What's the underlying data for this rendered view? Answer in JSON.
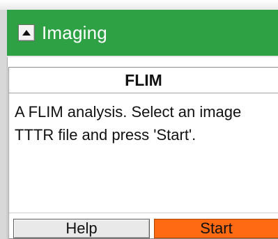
{
  "section": {
    "title": "Imaging"
  },
  "panel": {
    "title": "FLIM",
    "description": "A FLIM analysis. Select an image TTTR file and press 'Start'.",
    "help_label": "Help",
    "start_label": "Start"
  },
  "colors": {
    "header_green": "#2ea144",
    "start_orange": "#ff6a12"
  },
  "icons": {
    "collapse": "triangle-up-icon"
  }
}
